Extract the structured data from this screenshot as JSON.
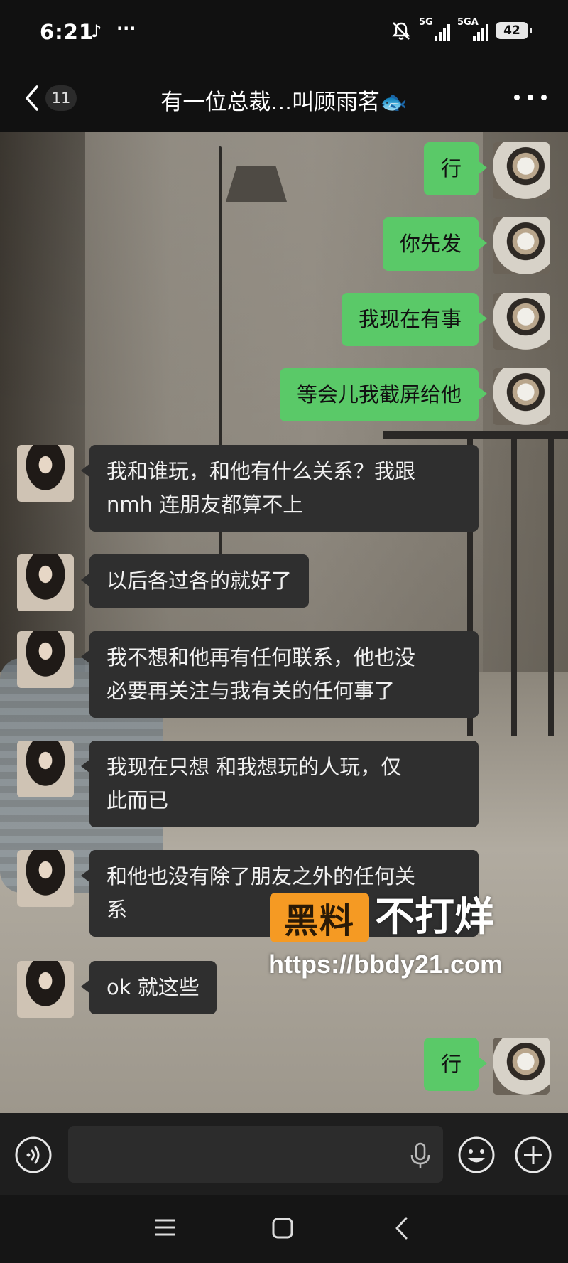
{
  "status_bar": {
    "time": "6:21",
    "tiktok_icon": "♪",
    "more_indicator": "···",
    "signal_1_label": "5G",
    "signal_2_label": "5GA",
    "battery": "42"
  },
  "header": {
    "unread_count": "11",
    "title": "有一位总裁...叫顾雨茗🐟"
  },
  "messages": [
    {
      "side": "out",
      "text": "行"
    },
    {
      "side": "out",
      "text": "你先发"
    },
    {
      "side": "out",
      "text": "我现在有事"
    },
    {
      "side": "out",
      "text": "等会儿我截屏给他"
    },
    {
      "side": "in",
      "line1": "我和谁玩，和他有什么关系？我跟",
      "line2": "nmh 连朋友都算不上"
    },
    {
      "side": "in",
      "text": "以后各过各的就好了"
    },
    {
      "side": "in",
      "line1": "我不想和他再有任何联系，他也没",
      "line2": "必要再关注与我有关的任何事了"
    },
    {
      "side": "in",
      "line1": "我现在只想 和我想玩的人玩，仅",
      "line2": "此而已"
    },
    {
      "side": "in",
      "line1": "和他也没有除了朋友之外的任何关",
      "line2": "系"
    },
    {
      "side": "in",
      "text": "ok 就这些"
    },
    {
      "side": "out",
      "text": "行"
    }
  ],
  "watermark": {
    "logo_text": "黑料",
    "slogan": "不打烊",
    "url": "https://bbdy21.com"
  },
  "icons": {
    "back": "back-icon",
    "more": "more-icon",
    "voice": "voice-icon",
    "mic": "mic-icon",
    "emoji": "emoji-icon",
    "plus": "plus-icon",
    "nav_menu": "menu-icon",
    "nav_home": "home-icon",
    "nav_back": "nav-back-icon"
  },
  "colors": {
    "outgoing_bubble": "#5ac968",
    "incoming_bubble": "#2f2f2f",
    "watermark_logo": "#f59a23"
  }
}
